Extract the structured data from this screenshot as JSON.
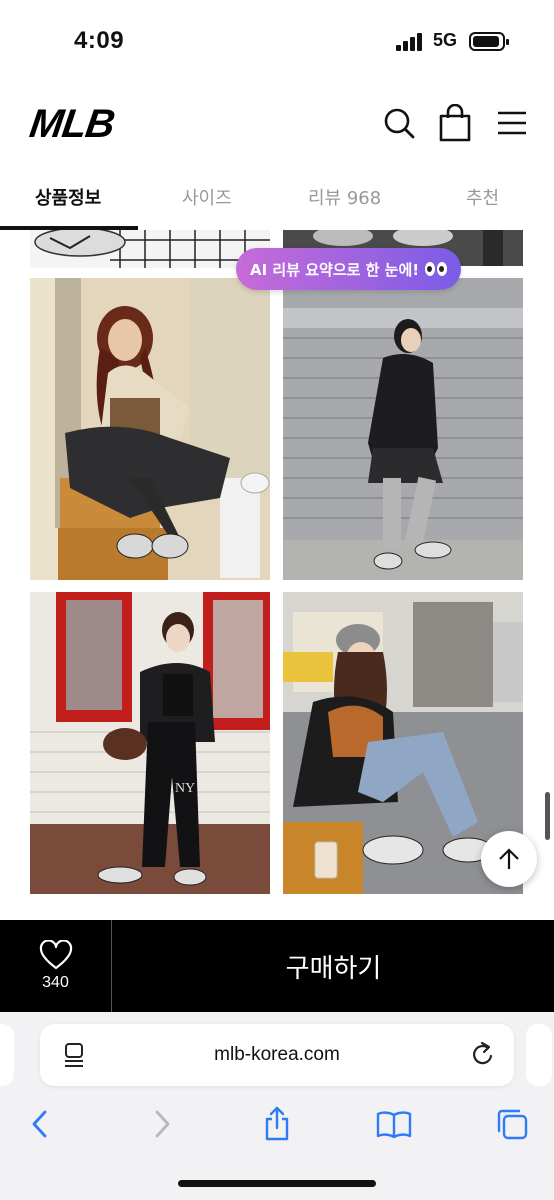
{
  "status_bar": {
    "time": "4:09",
    "network": "5G"
  },
  "header": {
    "logo": "MLB",
    "icons": [
      "search-icon",
      "shopping-bag-icon",
      "menu-icon"
    ]
  },
  "tabs": [
    {
      "label": "상품정보",
      "active": true
    },
    {
      "label": "사이즈",
      "active": false
    },
    {
      "label": "리뷰 968",
      "active": false
    },
    {
      "label": "추천",
      "active": false
    }
  ],
  "ai_summary_pill": {
    "label": "AI 리뷰 요약으로 한 눈에!"
  },
  "purchase_bar": {
    "like_count": "340",
    "buy_label": "구매하기"
  },
  "browser": {
    "url": "mlb-korea.com"
  },
  "colors": {
    "accent_gradient_start": "#c76bd8",
    "accent_gradient_end": "#7b5ce6",
    "buy_bar": "#000000",
    "safari_link": "#2f7cf6"
  }
}
